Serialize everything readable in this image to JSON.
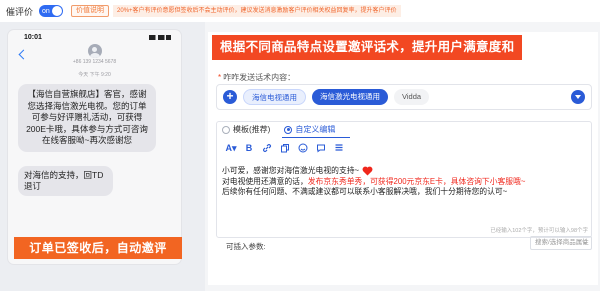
{
  "topbar": {
    "label": "催评价",
    "toggle_text": "on",
    "badge": "价值说明",
    "tip": "20%+客户有评价意愿但签收后不会主动评价，建议发送消息激励客户评价相关权益回复率，提升客户评价"
  },
  "phone": {
    "time": "10:01",
    "sender_line": "+86 139 1234 5678",
    "date_line": "今天 下午 9:20",
    "message1": "【海信自营旗舰店】客官，感谢您选择海信激光电视。您的订单可参与好评赠礼活动，可获得200E卡哦，具体参与方式可咨询在线客服呦~再次感谢您",
    "message2": "对海信的支持，回TD退订"
  },
  "callouts": {
    "left": "订单已签收后，自动邀评",
    "right": "根据不同商品特点设置邀评话术，提升用户满意度和粘性"
  },
  "form": {
    "field_label": "咋咋发送话术内容：",
    "required_mark": "*",
    "tags": [
      "海信电视通用",
      "海信激光电视通用",
      "Vidda"
    ],
    "radio_template": "模板(推荐)",
    "radio_custom": "自定义编辑",
    "editor_line1": "小可爱，感谢您对海信激光电视的支持~",
    "editor_line2_prefix": "对电视使用还满意的话，",
    "editor_line2_red": "发布京东秀单秀，可获得200元京东E卡，具体咨询下小客服哦~",
    "editor_line3": "后续你有任何问题、不满或建议都可以联系小客服解决哦，我们十分期待您的认可~",
    "counter": "已经输入102个字，预计可以输入98个字",
    "insert_label": "可插入参数:",
    "insert_placeholder": "搜索/选择商品属性"
  },
  "colors": {
    "brand_blue": "#2a5bd7",
    "callout_orange": "#f26522",
    "callout_red": "#f24822",
    "highlight_red": "#f0271c"
  }
}
